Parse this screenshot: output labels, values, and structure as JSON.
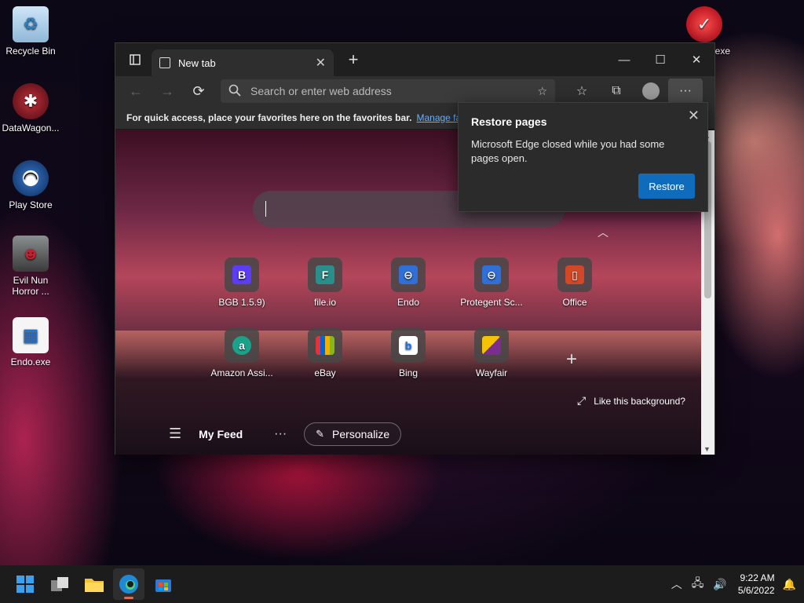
{
  "desktop": {
    "icons": [
      {
        "label": "Recycle Bin"
      },
      {
        "label": "DataWagon..."
      },
      {
        "label": "Play Store"
      },
      {
        "label": "Evil Nun Horror ..."
      },
      {
        "label": "Endo.exe"
      },
      {
        "label": "nt exe"
      }
    ]
  },
  "browser": {
    "tab": {
      "label": "New tab"
    },
    "address": {
      "placeholder": "Search or enter web address"
    },
    "favbar": {
      "text": "For quick access, place your favorites here on the favorites bar.",
      "link": "Manage favori"
    },
    "tiles": [
      {
        "label": "BGB 1.5.9)",
        "glyph": "B",
        "color": "#5b3df5"
      },
      {
        "label": "file.io",
        "glyph": "F",
        "color": "#2a8f8a"
      },
      {
        "label": "Endo",
        "glyph": "e",
        "color": "#2f6fd6"
      },
      {
        "label": "Protegent Sc...",
        "glyph": "e",
        "color": "#2f6fd6"
      },
      {
        "label": "Office",
        "glyph": "O",
        "color": "#d24726"
      },
      {
        "label": "Amazon Assi...",
        "glyph": "a",
        "color": "#1aa38a"
      },
      {
        "label": "eBay",
        "glyph": "e",
        "color": "#222222"
      },
      {
        "label": "Bing",
        "glyph": "b",
        "color": "#ffffff"
      },
      {
        "label": "Wayfair",
        "glyph": "W",
        "color": "#7b2c8f"
      }
    ],
    "like_background": "Like this background?",
    "feed": {
      "my_feed": "My Feed",
      "personalize": "Personalize"
    }
  },
  "popup": {
    "title": "Restore pages",
    "body": "Microsoft Edge closed while you had some pages open.",
    "button": "Restore"
  },
  "taskbar": {
    "time": "9:22 AM",
    "date": "5/6/2022"
  },
  "colors": {
    "accent": "#0f6cbd",
    "link": "#6ab0ff"
  }
}
